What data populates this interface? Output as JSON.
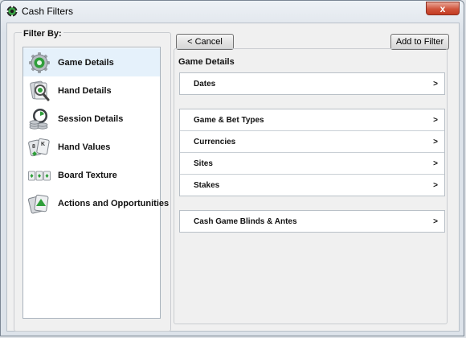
{
  "window": {
    "title": "Cash Filters",
    "close_glyph": "x"
  },
  "left_panel": {
    "heading": "Filter By:",
    "items": [
      {
        "label": "Game Details",
        "icon": "gear-icon",
        "selected": true
      },
      {
        "label": "Hand Details",
        "icon": "cards-magnifier-icon"
      },
      {
        "label": "Session Details",
        "icon": "chips-clock-icon"
      },
      {
        "label": "Hand Values",
        "icon": "playing-cards-icon"
      },
      {
        "label": "Board Texture",
        "icon": "board-cards-icon"
      },
      {
        "label": "Actions and Opportunities",
        "icon": "cards-arrow-icon"
      }
    ]
  },
  "toolbar": {
    "cancel_label": "< Cancel",
    "add_label": "Add to Filter"
  },
  "main": {
    "section_title": "Game Details",
    "chevron": ">",
    "groups": [
      {
        "rows": [
          "Dates"
        ]
      },
      {
        "rows": [
          "Game & Bet Types",
          "Currencies",
          "Sites",
          "Stakes"
        ]
      },
      {
        "rows": [
          "Cash Game Blinds & Antes"
        ]
      }
    ]
  },
  "colors": {
    "selected_item_bg": "#e5f1fb",
    "close_button": "#c43c22",
    "icon_green": "#2f9e3a"
  }
}
